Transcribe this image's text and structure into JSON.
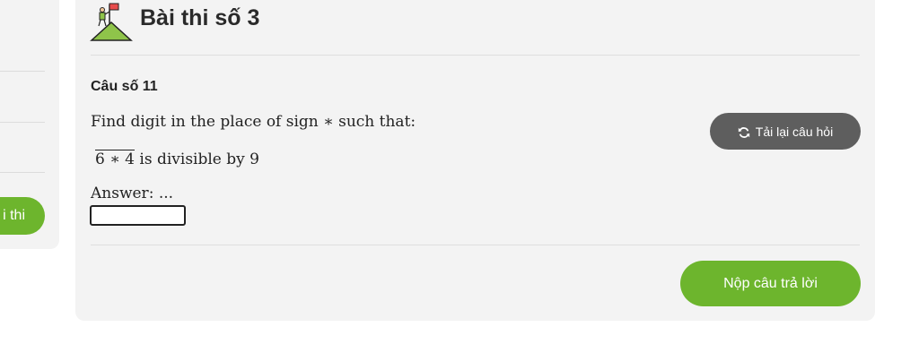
{
  "sidebar": {
    "button_label": "i thi"
  },
  "header": {
    "title": "Bài thi số 3",
    "logo_icon": "mountain-flag-icon"
  },
  "question": {
    "number_label": "Câu số 11",
    "text": "Find digit in the place of sign  ∗ such that:",
    "number_expression": "6 ∗ 4",
    "condition_text": " is divisible by 9",
    "answer_label": "Answer:  ...",
    "answer_value": ""
  },
  "actions": {
    "reload_label": "Tải lại câu hỏi",
    "reload_icon": "refresh-icon",
    "submit_label": "Nộp câu trả lời"
  },
  "colors": {
    "accent_green": "#6db52d",
    "reload_gray": "#5e5e5e",
    "card_bg": "#f3f3f3"
  }
}
